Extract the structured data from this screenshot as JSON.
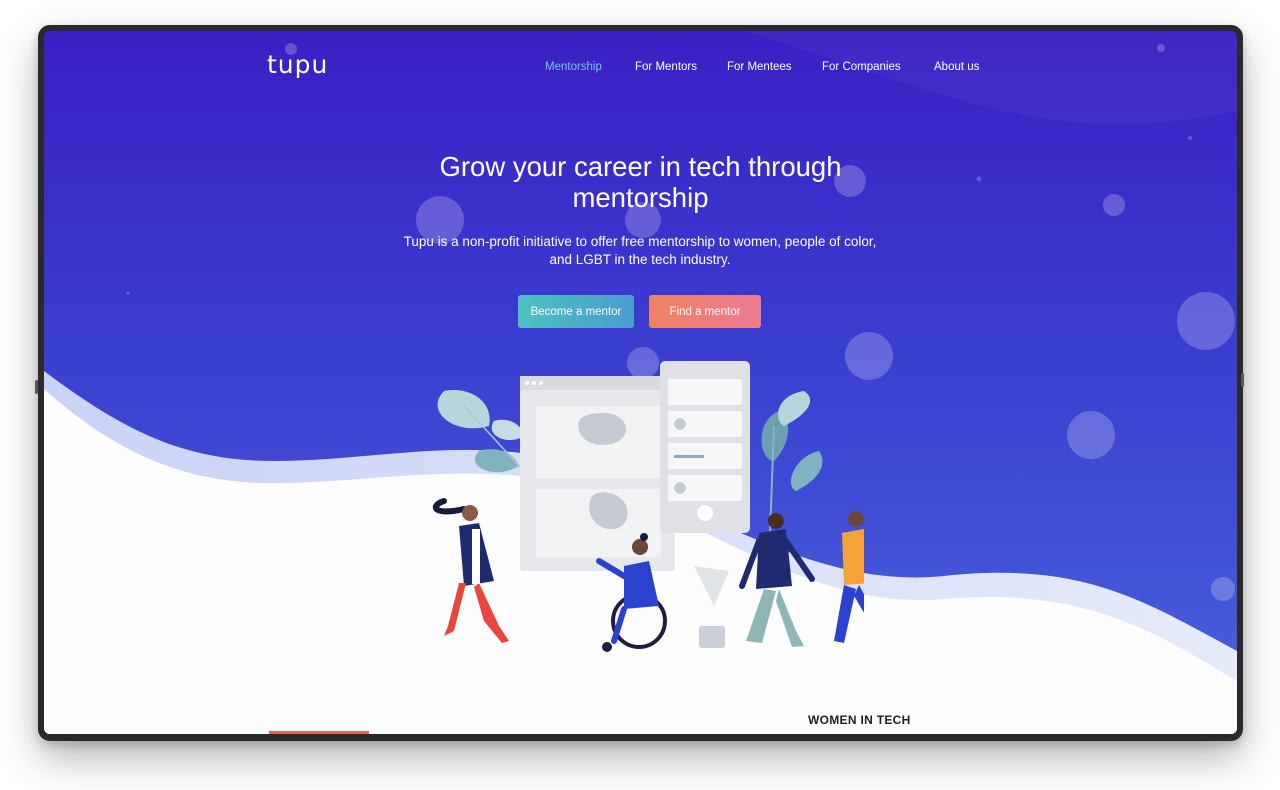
{
  "brand": {
    "logo_text": "tupu"
  },
  "nav": {
    "items": [
      {
        "label": "Mentorship",
        "active": true
      },
      {
        "label": "For Mentors",
        "active": false
      },
      {
        "label": "For Mentees",
        "active": false
      },
      {
        "label": "For Companies",
        "active": false
      },
      {
        "label": "About us",
        "active": false
      }
    ]
  },
  "hero": {
    "title_line1": "Grow your career in tech through",
    "title_line2": "mentorship",
    "subtitle_line1": "Tupu is a non-profit initiative to offer free mentorship to women, people of color,",
    "subtitle_line2": "and LGBT in the tech industry.",
    "primary_button": "Become a mentor",
    "secondary_button": "Find a mentor"
  },
  "next_section": {
    "label": "WOMEN IN TECH"
  },
  "colors": {
    "hero_gradient_top": "#3a1fc4",
    "hero_gradient_bottom": "#4a63dc",
    "nav_active": "#79c6f3",
    "button_mentor": "#4fc0c0",
    "button_find": "#ef8160"
  },
  "illustration": {
    "name": "people-walking-mentorship-illustration"
  }
}
